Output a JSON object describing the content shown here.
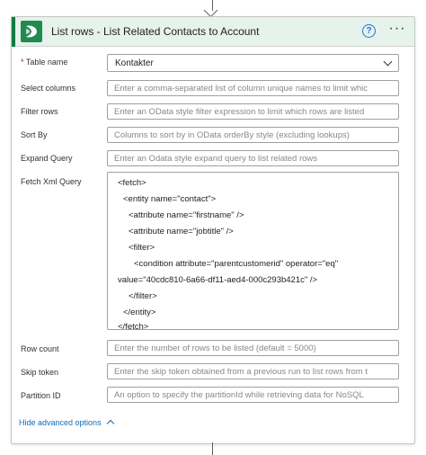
{
  "action": {
    "title": "List rows - List Related Contacts to Account",
    "help_glyph": "?",
    "more_glyph": "···",
    "brand_color": "#107c41"
  },
  "fields": {
    "table_name": {
      "required_mark": "*",
      "label": "Table name",
      "value": "Kontakter"
    },
    "select_columns": {
      "label": "Select columns",
      "placeholder": "Enter a comma-separated list of column unique names to limit whic"
    },
    "filter_rows": {
      "label": "Filter rows",
      "placeholder": "Enter an OData style filter expression to limit which rows are listed"
    },
    "sort_by": {
      "label": "Sort By",
      "placeholder": "Columns to sort by in OData orderBy style (excluding lookups)"
    },
    "expand_query": {
      "label": "Expand Query",
      "placeholder": "Enter an Odata style expand query to list related rows"
    },
    "fetch_xml": {
      "label": "Fetch Xml Query",
      "lines": [
        "<fetch>",
        "<entity name=\"contact\">",
        "<attribute name=\"firstname\" />",
        "<attribute name=\"jobtitle\" />",
        "<filter>",
        "<condition attribute=\"parentcustomerid\" operator=\"eq\"",
        "value=\"40cdc810-6a66-df11-aed4-000c293b421c\" />",
        "</filter>",
        "</entity>",
        "</fetch>"
      ]
    },
    "row_count": {
      "label": "Row count",
      "placeholder": "Enter the number of rows to be listed (default = 5000)"
    },
    "skip_token": {
      "label": "Skip token",
      "placeholder": "Enter the skip token obtained from a previous run to list rows from t"
    },
    "partition_id": {
      "label": "Partition ID",
      "placeholder": "An option to specify the partitionId while retrieving data for NoSQL"
    }
  },
  "advanced": {
    "label": "Hide advanced options"
  }
}
